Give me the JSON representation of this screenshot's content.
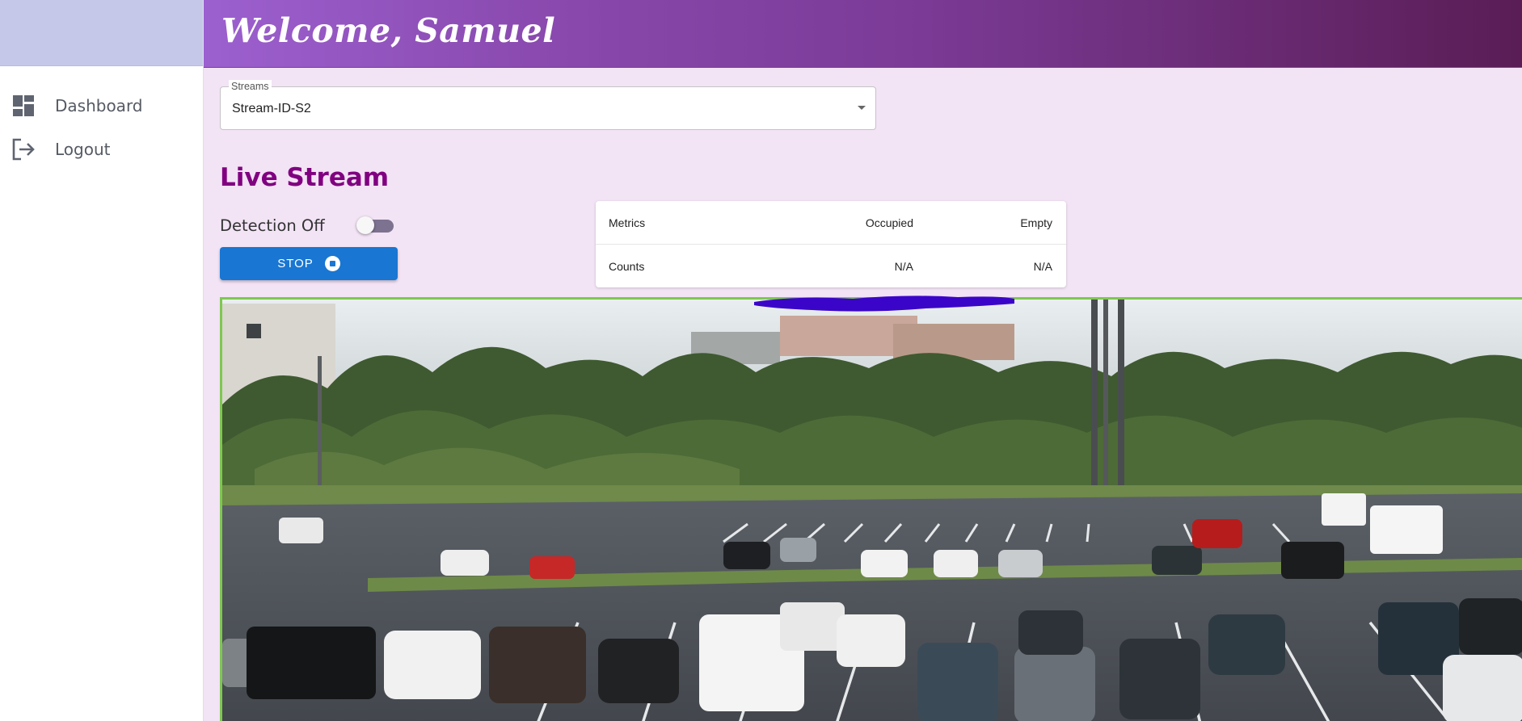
{
  "header": {
    "title": "Welcome, Samuel"
  },
  "sidebar": {
    "items": [
      {
        "label": "Dashboard",
        "icon": "dashboard-icon"
      },
      {
        "label": "Logout",
        "icon": "logout-icon"
      }
    ]
  },
  "streams": {
    "label": "Streams",
    "selected": "Stream-ID-S2"
  },
  "live": {
    "title": "Live Stream",
    "detection_label": "Detection Off",
    "detection_on": false,
    "stop_label": "STOP"
  },
  "metrics": {
    "headers": [
      "Metrics",
      "Occupied",
      "Empty"
    ],
    "rows": [
      {
        "label": "Counts",
        "occupied": "N/A",
        "empty": "N/A"
      }
    ]
  },
  "colors": {
    "accent": "#1976d2",
    "title": "#800080",
    "page_bg": "#f2e3f5",
    "video_border": "#7ec850",
    "scribble": "#3a05c8"
  },
  "video": {
    "subject": "parking-lot-camera-feed"
  }
}
